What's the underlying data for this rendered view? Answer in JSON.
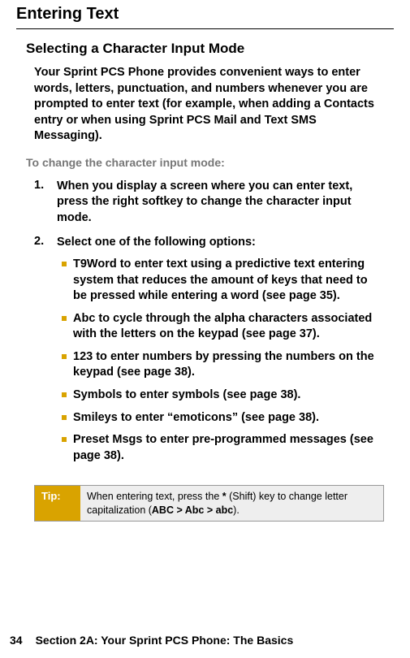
{
  "title": "Entering Text",
  "subhead": "Selecting a Character Input Mode",
  "intro": "Your Sprint PCS Phone provides convenient ways to enter words, letters, punctuation, and numbers whenever you are prompted to enter text (for example, when adding a Contacts entry or when using Sprint PCS Mail and Text SMS Messaging).",
  "lead": "To change the character input mode:",
  "steps": [
    {
      "num": "1.",
      "text": "When you display a screen where you can enter text, press the right softkey to change the character input mode."
    },
    {
      "num": "2.",
      "text": "Select one of the following options:"
    }
  ],
  "options": [
    {
      "bold": "T9Word",
      "rest": " to enter text using a predictive text entering system that reduces the amount of keys that need to be pressed while entering a word (see page 35)."
    },
    {
      "bold": "Abc",
      "rest": " to cycle through the alpha characters associated with the letters on the keypad (see page 37)."
    },
    {
      "bold": "123",
      "rest": " to enter numbers by pressing the numbers on the keypad (see page 38)."
    },
    {
      "bold": "Symbols",
      "rest": " to enter symbols (see page 38)."
    },
    {
      "bold": "Smileys",
      "rest": " to enter “emoticons” (see page 38)."
    },
    {
      "bold": "Preset Msgs",
      "rest": " to enter pre-programmed messages (see page 38)."
    }
  ],
  "tip": {
    "label": "Tip:",
    "pre": "When entering text, press the ",
    "key": "*",
    "mid": " (Shift) key to change letter capitalization (",
    "seq": "ABC > Abc > abc",
    "post": ")."
  },
  "footer": {
    "pageNum": "34",
    "runhead": "Section 2A: Your Sprint PCS Phone: The Basics"
  }
}
